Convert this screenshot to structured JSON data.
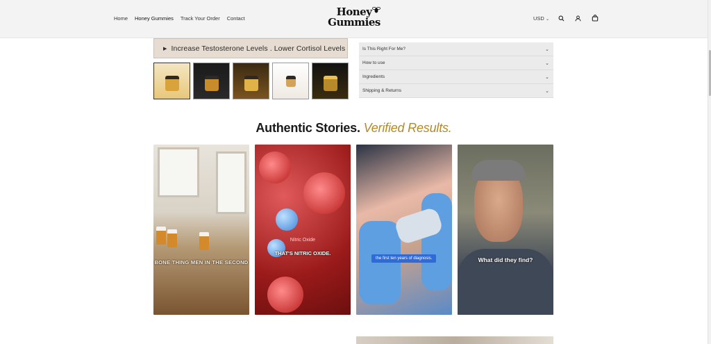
{
  "header": {
    "nav": [
      "Home",
      "Honey Gummies",
      "Track Your Order",
      "Contact"
    ],
    "logo_line1": "Honey",
    "logo_line2": "Gummies",
    "currency": "USD"
  },
  "product": {
    "banner_text": "Increase Testosterone Levels .  Lower Cortisol Levels",
    "accordion": [
      "Is This Right For Me?",
      "How to use",
      "Ingredients",
      "Shipping & Returns"
    ]
  },
  "stories": {
    "title_main": "Authentic Stories.",
    "title_accent": "Verified Results.",
    "videos": [
      {
        "caption": "BONE THING MEN IN THE SECOND"
      },
      {
        "caption_top": "Nitric Oxide",
        "caption": "THAT'S NITRIC OXIDE."
      },
      {
        "caption": "the first ten years of diagnosis."
      },
      {
        "caption": "What did they find?"
      }
    ]
  },
  "colors": {
    "accent": "#b08a2b",
    "banner_bg": "#e7dcd2",
    "accordion_bg": "#ebebeb",
    "header_bg": "#f3f3f3"
  }
}
